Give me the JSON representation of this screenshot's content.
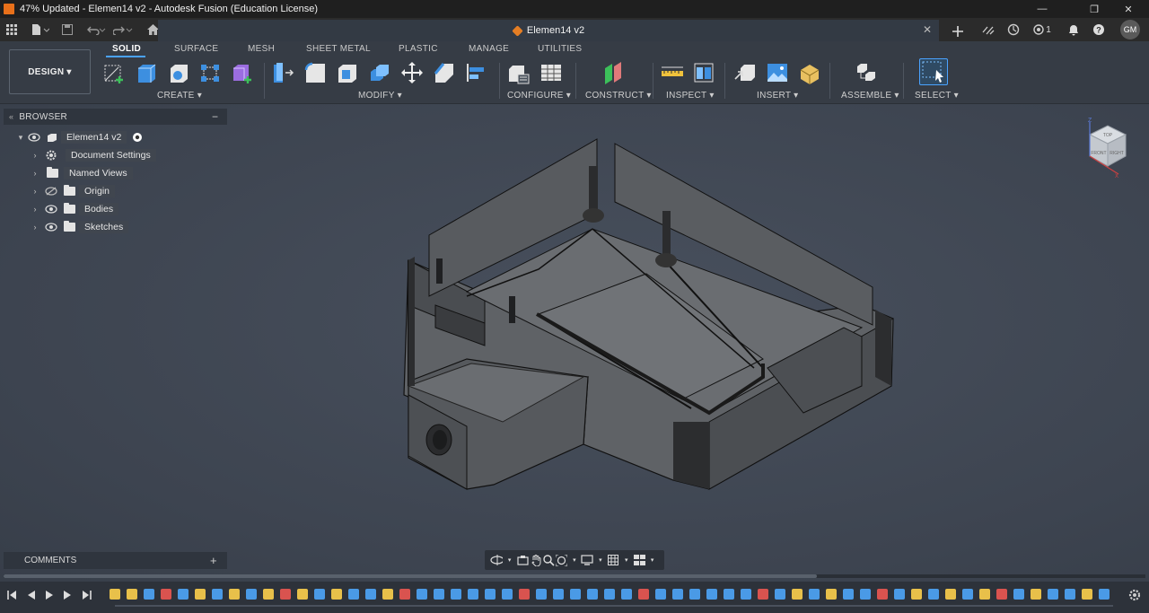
{
  "window": {
    "title": "47% Updated - Elemen14 v2 - Autodesk Fusion (Education License)",
    "controls": [
      "—",
      "❐",
      "✕"
    ]
  },
  "appbar": {
    "document_tab": "Elemen14 v2",
    "job_count": "1",
    "user_initials": "GM"
  },
  "toolbar": {
    "workspace": "DESIGN ▾",
    "tabs": [
      "SOLID",
      "SURFACE",
      "MESH",
      "SHEET METAL",
      "PLASTIC",
      "MANAGE",
      "UTILITIES"
    ],
    "active_tab": "SOLID",
    "groups": [
      "CREATE ▾",
      "MODIFY ▾",
      "CONFIGURE ▾",
      "CONSTRUCT ▾",
      "INSPECT ▾",
      "INSERT ▾",
      "ASSEMBLE ▾",
      "SELECT ▾"
    ]
  },
  "browser": {
    "title": "BROWSER",
    "root": "Elemen14 v2",
    "items": [
      "Document Settings",
      "Named Views",
      "Origin",
      "Bodies",
      "Sketches"
    ]
  },
  "comments": {
    "title": "COMMENTS"
  },
  "viewcube": {
    "faces": [
      "TOP",
      "FRONT",
      "RIGHT"
    ],
    "axis_z": "Z",
    "axis_x": "X"
  },
  "colors": {
    "accent": "#4aa3ff",
    "viewport": "#3e4552",
    "toolbar": "#363c45"
  }
}
